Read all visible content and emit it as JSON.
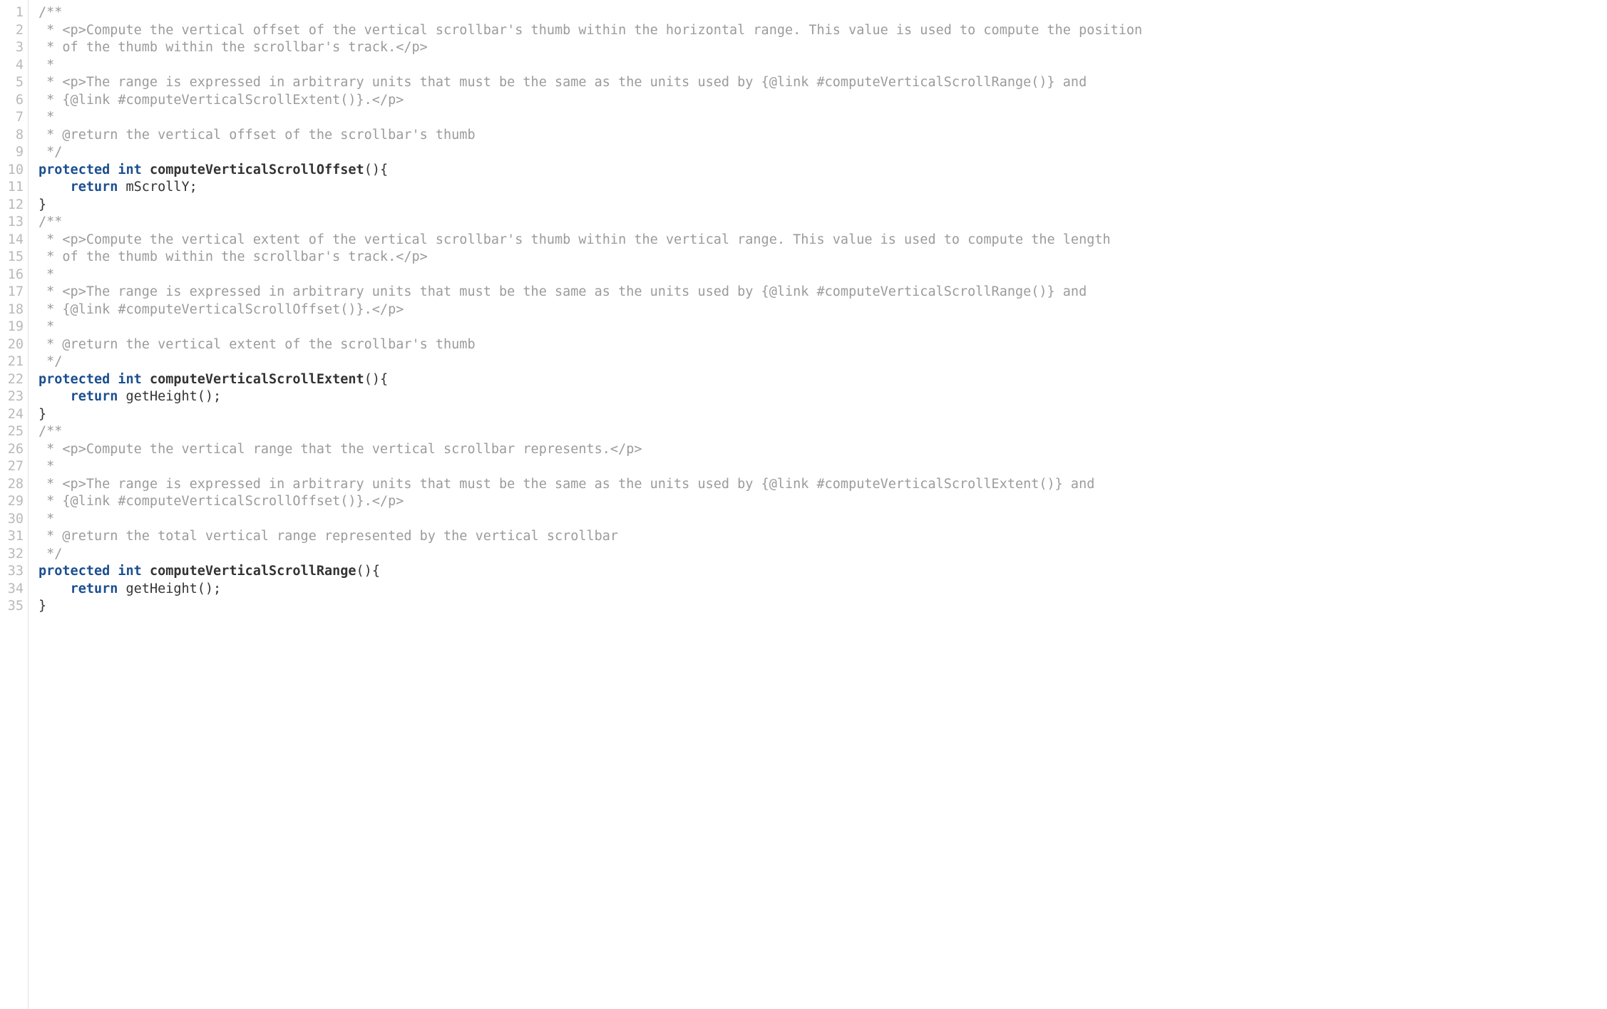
{
  "lines": [
    {
      "num": 1,
      "tokens": [
        {
          "cls": "tok-comment",
          "t": "/**"
        }
      ]
    },
    {
      "num": 2,
      "tokens": [
        {
          "cls": "tok-comment",
          "t": " * <p>Compute the vertical offset of the vertical scrollbar's thumb within the horizontal range. This value is used to compute the position"
        }
      ]
    },
    {
      "num": 3,
      "tokens": [
        {
          "cls": "tok-comment",
          "t": " * of the thumb within the scrollbar's track.</p>"
        }
      ]
    },
    {
      "num": 4,
      "tokens": [
        {
          "cls": "tok-comment",
          "t": " *"
        }
      ]
    },
    {
      "num": 5,
      "tokens": [
        {
          "cls": "tok-comment",
          "t": " * <p>The range is expressed in arbitrary units that must be the same as the units used by {@link #computeVerticalScrollRange()} and"
        }
      ]
    },
    {
      "num": 6,
      "tokens": [
        {
          "cls": "tok-comment",
          "t": " * {@link #computeVerticalScrollExtent()}.</p>"
        }
      ]
    },
    {
      "num": 7,
      "tokens": [
        {
          "cls": "tok-comment",
          "t": " *"
        }
      ]
    },
    {
      "num": 8,
      "tokens": [
        {
          "cls": "tok-comment",
          "t": " * @return the vertical offset of the scrollbar's thumb"
        }
      ]
    },
    {
      "num": 9,
      "tokens": [
        {
          "cls": "tok-comment",
          "t": " */"
        }
      ]
    },
    {
      "num": 10,
      "tokens": [
        {
          "cls": "tok-keyword",
          "t": "protected"
        },
        {
          "cls": "tok-plain",
          "t": " "
        },
        {
          "cls": "tok-keyword",
          "t": "int"
        },
        {
          "cls": "tok-plain",
          "t": " "
        },
        {
          "cls": "tok-ident",
          "t": "computeVerticalScrollOffset"
        },
        {
          "cls": "tok-plain",
          "t": "(){"
        }
      ]
    },
    {
      "num": 11,
      "tokens": [
        {
          "cls": "tok-plain",
          "t": "    "
        },
        {
          "cls": "tok-keyword",
          "t": "return"
        },
        {
          "cls": "tok-plain",
          "t": " mScrollY;"
        }
      ]
    },
    {
      "num": 12,
      "tokens": [
        {
          "cls": "tok-plain",
          "t": "}"
        }
      ]
    },
    {
      "num": 13,
      "tokens": [
        {
          "cls": "tok-comment",
          "t": "/**"
        }
      ]
    },
    {
      "num": 14,
      "tokens": [
        {
          "cls": "tok-comment",
          "t": " * <p>Compute the vertical extent of the vertical scrollbar's thumb within the vertical range. This value is used to compute the length"
        }
      ]
    },
    {
      "num": 15,
      "tokens": [
        {
          "cls": "tok-comment",
          "t": " * of the thumb within the scrollbar's track.</p>"
        }
      ]
    },
    {
      "num": 16,
      "tokens": [
        {
          "cls": "tok-comment",
          "t": " *"
        }
      ]
    },
    {
      "num": 17,
      "tokens": [
        {
          "cls": "tok-comment",
          "t": " * <p>The range is expressed in arbitrary units that must be the same as the units used by {@link #computeVerticalScrollRange()} and"
        }
      ]
    },
    {
      "num": 18,
      "tokens": [
        {
          "cls": "tok-comment",
          "t": " * {@link #computeVerticalScrollOffset()}.</p>"
        }
      ]
    },
    {
      "num": 19,
      "tokens": [
        {
          "cls": "tok-comment",
          "t": " *"
        }
      ]
    },
    {
      "num": 20,
      "tokens": [
        {
          "cls": "tok-comment",
          "t": " * @return the vertical extent of the scrollbar's thumb"
        }
      ]
    },
    {
      "num": 21,
      "tokens": [
        {
          "cls": "tok-comment",
          "t": " */"
        }
      ]
    },
    {
      "num": 22,
      "tokens": [
        {
          "cls": "tok-keyword",
          "t": "protected"
        },
        {
          "cls": "tok-plain",
          "t": " "
        },
        {
          "cls": "tok-keyword",
          "t": "int"
        },
        {
          "cls": "tok-plain",
          "t": " "
        },
        {
          "cls": "tok-ident",
          "t": "computeVerticalScrollExtent"
        },
        {
          "cls": "tok-plain",
          "t": "(){"
        }
      ]
    },
    {
      "num": 23,
      "tokens": [
        {
          "cls": "tok-plain",
          "t": "    "
        },
        {
          "cls": "tok-keyword",
          "t": "return"
        },
        {
          "cls": "tok-plain",
          "t": " getHeight();"
        }
      ]
    },
    {
      "num": 24,
      "tokens": [
        {
          "cls": "tok-plain",
          "t": "}"
        }
      ]
    },
    {
      "num": 25,
      "tokens": [
        {
          "cls": "tok-comment",
          "t": "/**"
        }
      ]
    },
    {
      "num": 26,
      "tokens": [
        {
          "cls": "tok-comment",
          "t": " * <p>Compute the vertical range that the vertical scrollbar represents.</p>"
        }
      ]
    },
    {
      "num": 27,
      "tokens": [
        {
          "cls": "tok-comment",
          "t": " *"
        }
      ]
    },
    {
      "num": 28,
      "tokens": [
        {
          "cls": "tok-comment",
          "t": " * <p>The range is expressed in arbitrary units that must be the same as the units used by {@link #computeVerticalScrollExtent()} and"
        }
      ]
    },
    {
      "num": 29,
      "tokens": [
        {
          "cls": "tok-comment",
          "t": " * {@link #computeVerticalScrollOffset()}.</p>"
        }
      ]
    },
    {
      "num": 30,
      "tokens": [
        {
          "cls": "tok-comment",
          "t": " *"
        }
      ]
    },
    {
      "num": 31,
      "tokens": [
        {
          "cls": "tok-comment",
          "t": " * @return the total vertical range represented by the vertical scrollbar"
        }
      ]
    },
    {
      "num": 32,
      "tokens": [
        {
          "cls": "tok-comment",
          "t": " */"
        }
      ]
    },
    {
      "num": 33,
      "tokens": [
        {
          "cls": "tok-keyword",
          "t": "protected"
        },
        {
          "cls": "tok-plain",
          "t": " "
        },
        {
          "cls": "tok-keyword",
          "t": "int"
        },
        {
          "cls": "tok-plain",
          "t": " "
        },
        {
          "cls": "tok-ident",
          "t": "computeVerticalScrollRange"
        },
        {
          "cls": "tok-plain",
          "t": "(){"
        }
      ]
    },
    {
      "num": 34,
      "tokens": [
        {
          "cls": "tok-plain",
          "t": "    "
        },
        {
          "cls": "tok-keyword",
          "t": "return"
        },
        {
          "cls": "tok-plain",
          "t": " getHeight();"
        }
      ]
    },
    {
      "num": 35,
      "tokens": [
        {
          "cls": "tok-plain",
          "t": "}"
        }
      ]
    }
  ]
}
